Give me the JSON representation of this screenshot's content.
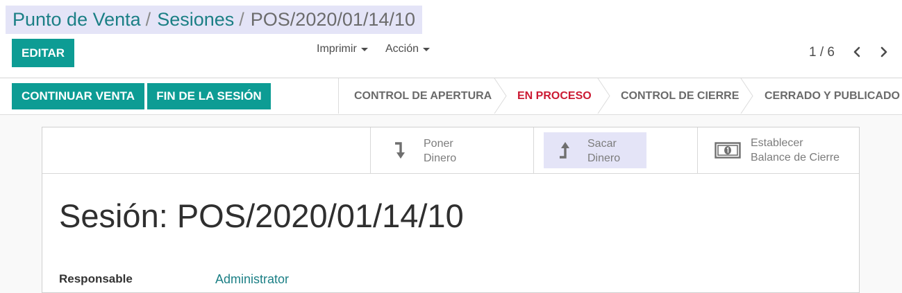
{
  "breadcrumb": {
    "items": [
      "Punto de Venta",
      "Sesiones"
    ],
    "separator": "/",
    "current": "POS/2020/01/14/10"
  },
  "toolbar": {
    "edit_label": "EDITAR",
    "print_label": "Imprimir",
    "action_label": "Acción"
  },
  "pager": {
    "value": "1 / 6"
  },
  "statusbar": {
    "continue_label": "CONTINUAR VENTA",
    "end_session_label": "FIN DE LA SESIÓN",
    "steps": [
      {
        "label": "CONTROL DE APERTURA",
        "active": false
      },
      {
        "label": "EN PROCESO",
        "active": true
      },
      {
        "label": "CONTROL DE CIERRE",
        "active": false
      },
      {
        "label": "CERRADO Y PUBLICADO",
        "active": false
      }
    ]
  },
  "button_box": {
    "put_money": [
      "Poner",
      "Dinero"
    ],
    "take_money": [
      "Sacar",
      "Dinero"
    ],
    "set_closing_balance": [
      "Establecer",
      "Balance de Cierre"
    ]
  },
  "form": {
    "title": "Sesión: POS/2020/01/14/10",
    "responsible_label": "Responsable",
    "responsible_value": "Administrator"
  },
  "icons": {
    "pager_prev": "chevron-left-icon",
    "pager_next": "chevron-right-icon",
    "put_money": "arrow-turn-down-icon",
    "take_money": "arrow-turn-up-icon",
    "closing_balance": "money-bill-icon"
  },
  "colors": {
    "primary": "#0d9c94",
    "link": "#1b7f85",
    "active_step": "#cb1a33",
    "breadcrumb_bg": "#e4e4f7"
  }
}
